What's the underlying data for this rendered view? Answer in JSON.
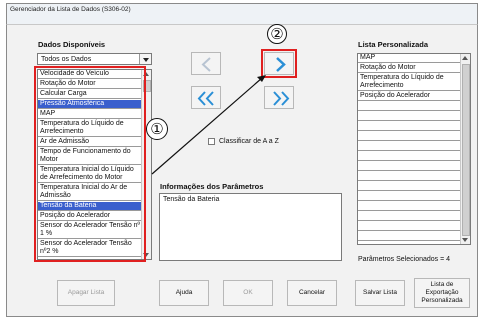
{
  "window": {
    "title": "Gerenciador da Lista de Dados (S306-02)"
  },
  "available": {
    "label": "Dados Disponíveis",
    "filter_value": "Todos os Dados",
    "items": [
      {
        "text": "Velocidade do Veículo",
        "selected": false
      },
      {
        "text": "Rotação do Motor",
        "selected": false
      },
      {
        "text": "Calcular Carga",
        "selected": false
      },
      {
        "text": "Pressão Atmosférica",
        "selected": true
      },
      {
        "text": "MAP",
        "selected": false
      },
      {
        "text": "Temperatura do Líquido de Arrefecimento",
        "selected": false
      },
      {
        "text": "Ar de Admissão",
        "selected": false
      },
      {
        "text": "Tempo de Funcionamento do Motor",
        "selected": false
      },
      {
        "text": "Temperatura Inicial do Líquido de Arrefecimento do Motor",
        "selected": false
      },
      {
        "text": "Temperatura Inicial do Ar de Admissão",
        "selected": false
      },
      {
        "text": "Tensão da Bateria",
        "selected": true
      },
      {
        "text": "Posição do Acelerador",
        "selected": false
      },
      {
        "text": "Sensor do Acelerador Tensão nº 1 %",
        "selected": false
      },
      {
        "text": "Sensor do Acelerador Tensão nº2 %",
        "selected": false
      }
    ]
  },
  "arrows": {
    "remove_one": "<",
    "add_one": ">",
    "remove_all": "<<",
    "add_all": ">>"
  },
  "callouts": {
    "one": "①",
    "two": "②"
  },
  "sort": {
    "label": "Classificar de A a Z",
    "checked": false
  },
  "info": {
    "label": "Informações dos Parâmetros",
    "text": "Tensão da Bateria"
  },
  "custom": {
    "label": "Lista Personalizada",
    "items": [
      "MAP",
      "Rotação do Motor",
      "Temperatura do Líquido de Arrefecimento",
      "Posição do Acelerador"
    ],
    "selected_count_text": "Parâmetros Selecionados = 4"
  },
  "buttons": {
    "clear": "Apagar Lista",
    "help": "Ajuda",
    "ok": "OK",
    "cancel": "Cancelar",
    "save": "Salvar Lista",
    "export": "Lista de Exportação Personalizada"
  },
  "colors": {
    "highlight": "#3a5fcd",
    "callout_red": "#e02020",
    "arrow_blue": "#2a8fd6"
  }
}
